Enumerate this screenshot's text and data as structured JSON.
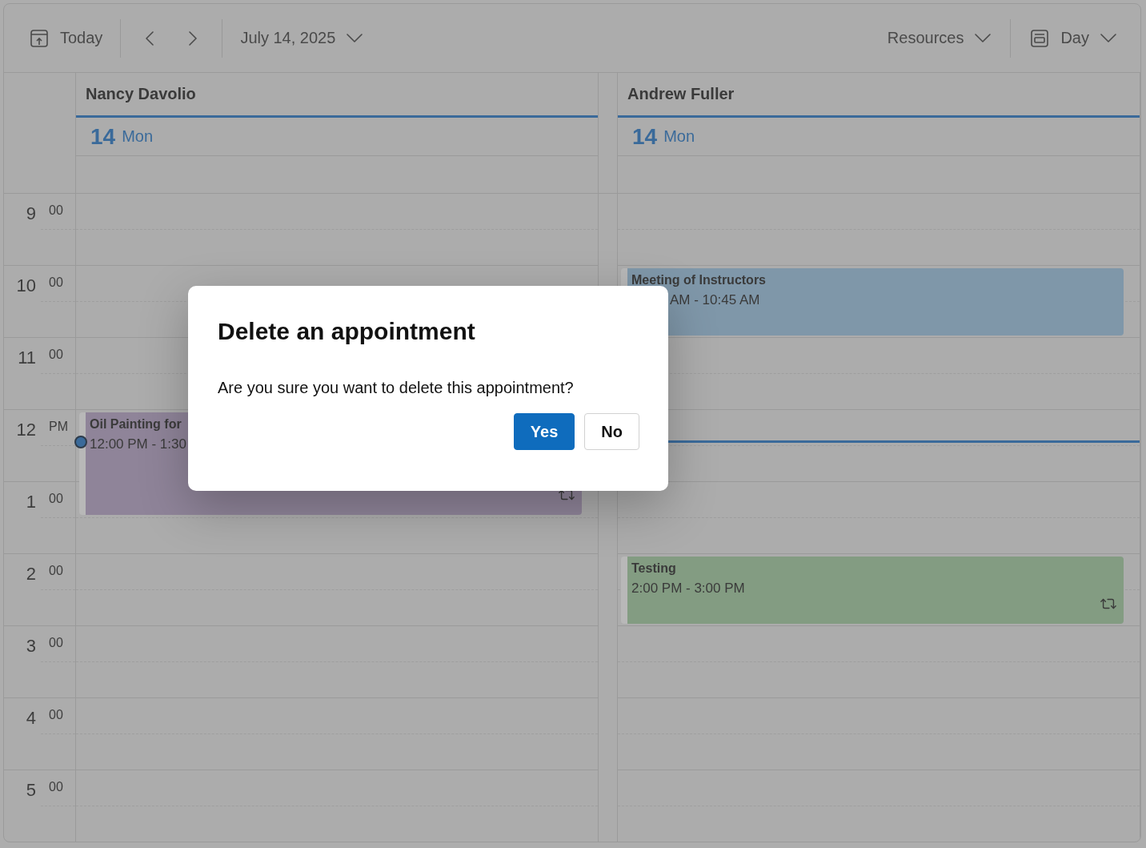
{
  "toolbar": {
    "today": "Today",
    "date": "July 14, 2025",
    "resources": "Resources",
    "view": "Day"
  },
  "resources": [
    {
      "name": "Nancy Davolio",
      "day_number": "14",
      "day_name": "Mon",
      "appointments": [
        {
          "title": "Oil Painting for",
          "time": "12:00 PM - 1:30",
          "recurring": true,
          "color": "#8f8499"
        }
      ]
    },
    {
      "name": "Andrew Fuller",
      "day_number": "14",
      "day_name": "Mon",
      "appointments": [
        {
          "title": "Meeting of Instructors",
          "time": "AM - 10:45 AM",
          "recurring": false,
          "color": "#7f97a9"
        },
        {
          "title": "Testing",
          "time": "2:00 PM - 3:00 PM",
          "recurring": true,
          "color": "#839c82"
        }
      ]
    }
  ],
  "time_slots": [
    {
      "hour": "9",
      "minutes": "00"
    },
    {
      "hour": "10",
      "minutes": "00"
    },
    {
      "hour": "11",
      "minutes": "00"
    },
    {
      "hour": "12",
      "minutes": "PM"
    },
    {
      "hour": "1",
      "minutes": "00"
    },
    {
      "hour": "2",
      "minutes": "00"
    },
    {
      "hour": "3",
      "minutes": "00"
    },
    {
      "hour": "4",
      "minutes": "00"
    },
    {
      "hour": "5",
      "minutes": "00"
    }
  ],
  "dialog": {
    "title": "Delete an appointment",
    "message": "Are you sure you want to delete this appointment?",
    "buttons": [
      {
        "label": "Yes",
        "primary": true
      },
      {
        "label": "No",
        "primary": false
      }
    ]
  }
}
